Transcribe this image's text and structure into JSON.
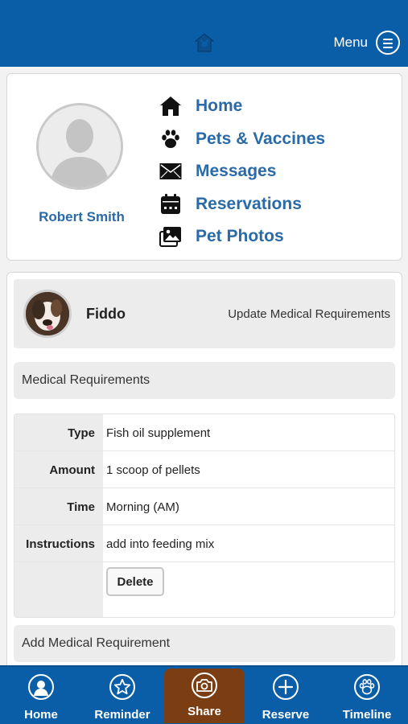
{
  "header": {
    "logo_icon": "house-paw-icon",
    "menu_label": "Menu",
    "menu_icon": "hamburger-circle-icon",
    "bg_color": "#0a5ea8"
  },
  "profile": {
    "user_name": "Robert Smith",
    "avatar_icon": "user-silhouette-icon",
    "nav": [
      {
        "label": "Home",
        "icon": "house-icon"
      },
      {
        "label": "Pets & Vaccines",
        "icon": "paw-icon"
      },
      {
        "label": "Messages",
        "icon": "envelope-icon"
      },
      {
        "label": "Reservations",
        "icon": "calendar-icon"
      },
      {
        "label": "Pet Photos",
        "icon": "photos-icon"
      }
    ]
  },
  "pet": {
    "name": "Fiddo",
    "update_label": "Update Medical Requirements"
  },
  "medical": {
    "section_title": "Medical Requirements",
    "rows": [
      {
        "key": "Type",
        "value": "Fish oil supplement"
      },
      {
        "key": "Amount",
        "value": "1 scoop of pellets"
      },
      {
        "key": "Time",
        "value": "Morning (AM)"
      },
      {
        "key": "Instructions",
        "value": "add into feeding mix"
      }
    ],
    "delete_label": "Delete",
    "add_label": "Add Medical Requirement"
  },
  "bottom_nav": {
    "active_color": "#7a3e12",
    "tabs": [
      {
        "label": "Home",
        "icon": "user-icon"
      },
      {
        "label": "Reminder",
        "icon": "star-icon"
      },
      {
        "label": "Share",
        "icon": "camera-icon"
      },
      {
        "label": "Reserve",
        "icon": "plus-icon"
      },
      {
        "label": "Timeline",
        "icon": "paw-icon"
      }
    ],
    "active_tab": "Share"
  }
}
